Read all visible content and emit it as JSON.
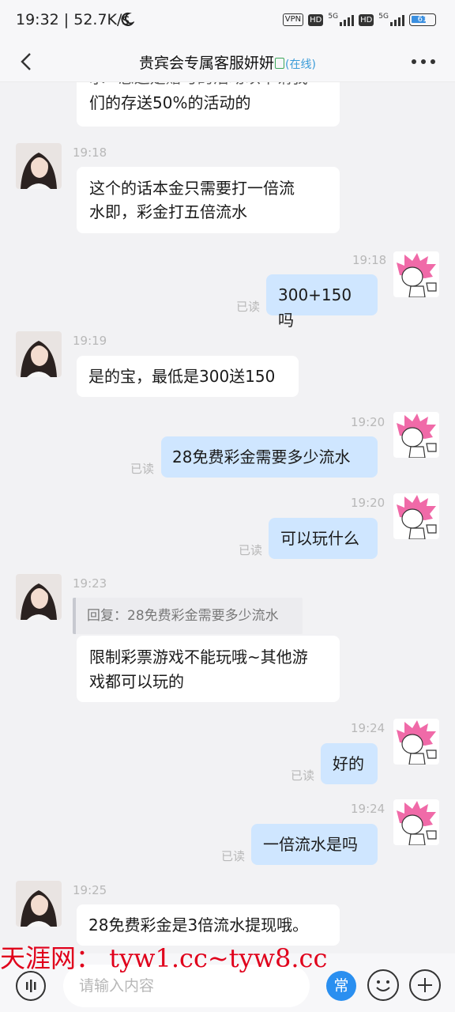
{
  "status_bar": {
    "time_speed": "19:32 | 52.7K/s",
    "vpn": "VPN",
    "hd1": "HD",
    "hd2": "HD",
    "net1": "5G",
    "net2": "5G",
    "battery": "61"
  },
  "header": {
    "title": "贵宾会专属客服妍妍",
    "status": "(在线)"
  },
  "messages": [
    {
      "side": "in",
      "text_line1": "求~您这是赠与的活动以中请我",
      "text_line2": "们的存送50%的活动的"
    },
    {
      "side": "in",
      "time": "19:18",
      "line1": "这个的话本金只需要打一倍流",
      "line2": "水即，彩金打五倍流水"
    },
    {
      "side": "out",
      "time": "19:18",
      "text": "300+150吗",
      "read": "已读"
    },
    {
      "side": "in",
      "time": "19:19",
      "text": "是的宝，最低是300送150"
    },
    {
      "side": "out",
      "time": "19:20",
      "text": "28免费彩金需要多少流水",
      "read": "已读"
    },
    {
      "side": "out",
      "time": "19:20",
      "text": "可以玩什么",
      "read": "已读"
    },
    {
      "side": "in",
      "time": "19:23",
      "quote": "回复：28免费彩金需要多少流水",
      "line1": "限制彩票游戏不能玩哦~其他游",
      "line2": "戏都可以玩的"
    },
    {
      "side": "out",
      "time": "19:24",
      "text": "好的",
      "read": "已读"
    },
    {
      "side": "out",
      "time": "19:24",
      "text": "一倍流水是吗",
      "read": "已读"
    },
    {
      "side": "in",
      "time": "19:25",
      "text": "28免费彩金是3倍流水提现哦。"
    }
  ],
  "watermark": "天涯网： tyw1.cc~tyw8.cc",
  "input": {
    "placeholder": "请输入内容",
    "common_label": "常"
  },
  "icons": [
    "back-arrow-icon",
    "more-dots-icon",
    "voice-icon",
    "emoji-icon",
    "plus-icon",
    "agent-avatar",
    "user-avatar"
  ],
  "colors": {
    "outgoing_bubble": "#cfe6ff",
    "incoming_bubble": "#ffffff",
    "accent": "#2a8ff0",
    "watermark": "#e0001b"
  }
}
